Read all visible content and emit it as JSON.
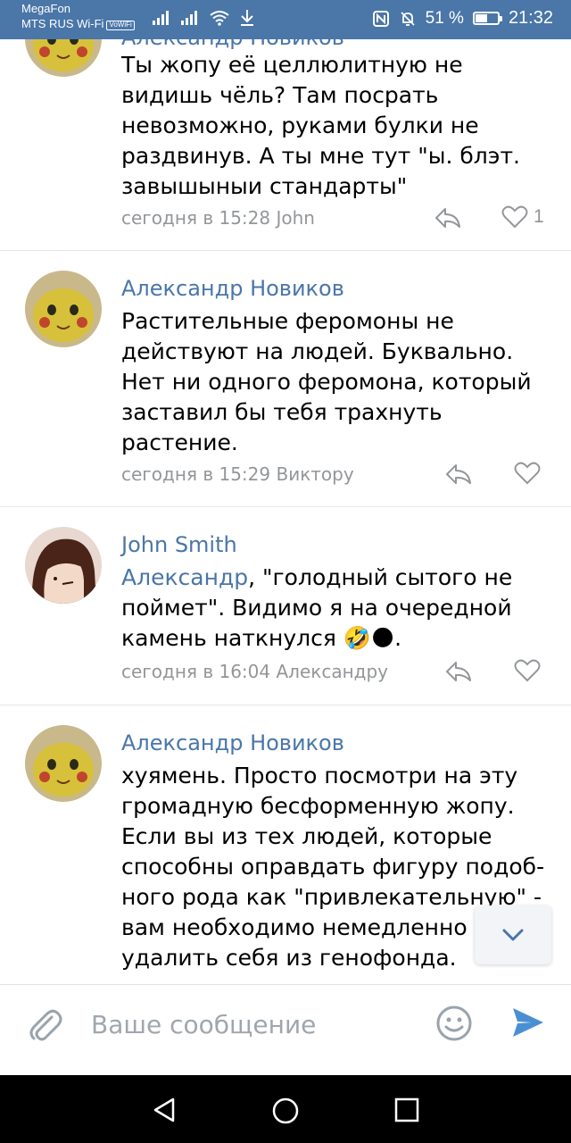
{
  "status_bar": {
    "carrier_1": "MegaFon",
    "carrier_2": "MTS RUS Wi-Fi",
    "volte": "VoWiFi",
    "battery_percent": "51 %",
    "battery_level": 0.51,
    "time": "21:32"
  },
  "messages": [
    {
      "author": "Александр Новиков",
      "text": "Ты жопу её целлюлитную не видишь чёль? Там посрать невозможно, руками булки не раздвинув. А ты мне тут \"ы. блэт. завышыныи стандарты\"",
      "meta": "сегодня в 15:28 John",
      "likes": "1"
    },
    {
      "author": "Александр Новиков",
      "text": "Растительные феромоны не действуют на людей. Буквально. Нет ни одного феромона, который заставил бы тебя трахнуть растение.",
      "meta": "сегодня в 15:29 Виктору",
      "likes": ""
    },
    {
      "author": "John Smith",
      "mention": "Александр",
      "text": ", \"голодный сытого не поймет\". Видимо я на очередной камень наткнулся",
      "emoji": "🤣🌑",
      "text_end": ".",
      "meta": "сегодня в 16:04 Александру",
      "likes": ""
    },
    {
      "author": "Александр Новиков",
      "text": "хуямень. Просто посмотри на эту громадную бесформенную жопу. Если вы из тех людей, которые способны оправдать фигуру подоб-ного рода как \"привлекательную\" - вам необходимо немедленно удалить себя из генофонда.",
      "meta": "",
      "likes": ""
    }
  ],
  "composer": {
    "placeholder": "Ваше сообщение"
  },
  "colors": {
    "accent": "#4a76a8",
    "meta_gray": "#939699",
    "divider": "#e3e6ea"
  }
}
